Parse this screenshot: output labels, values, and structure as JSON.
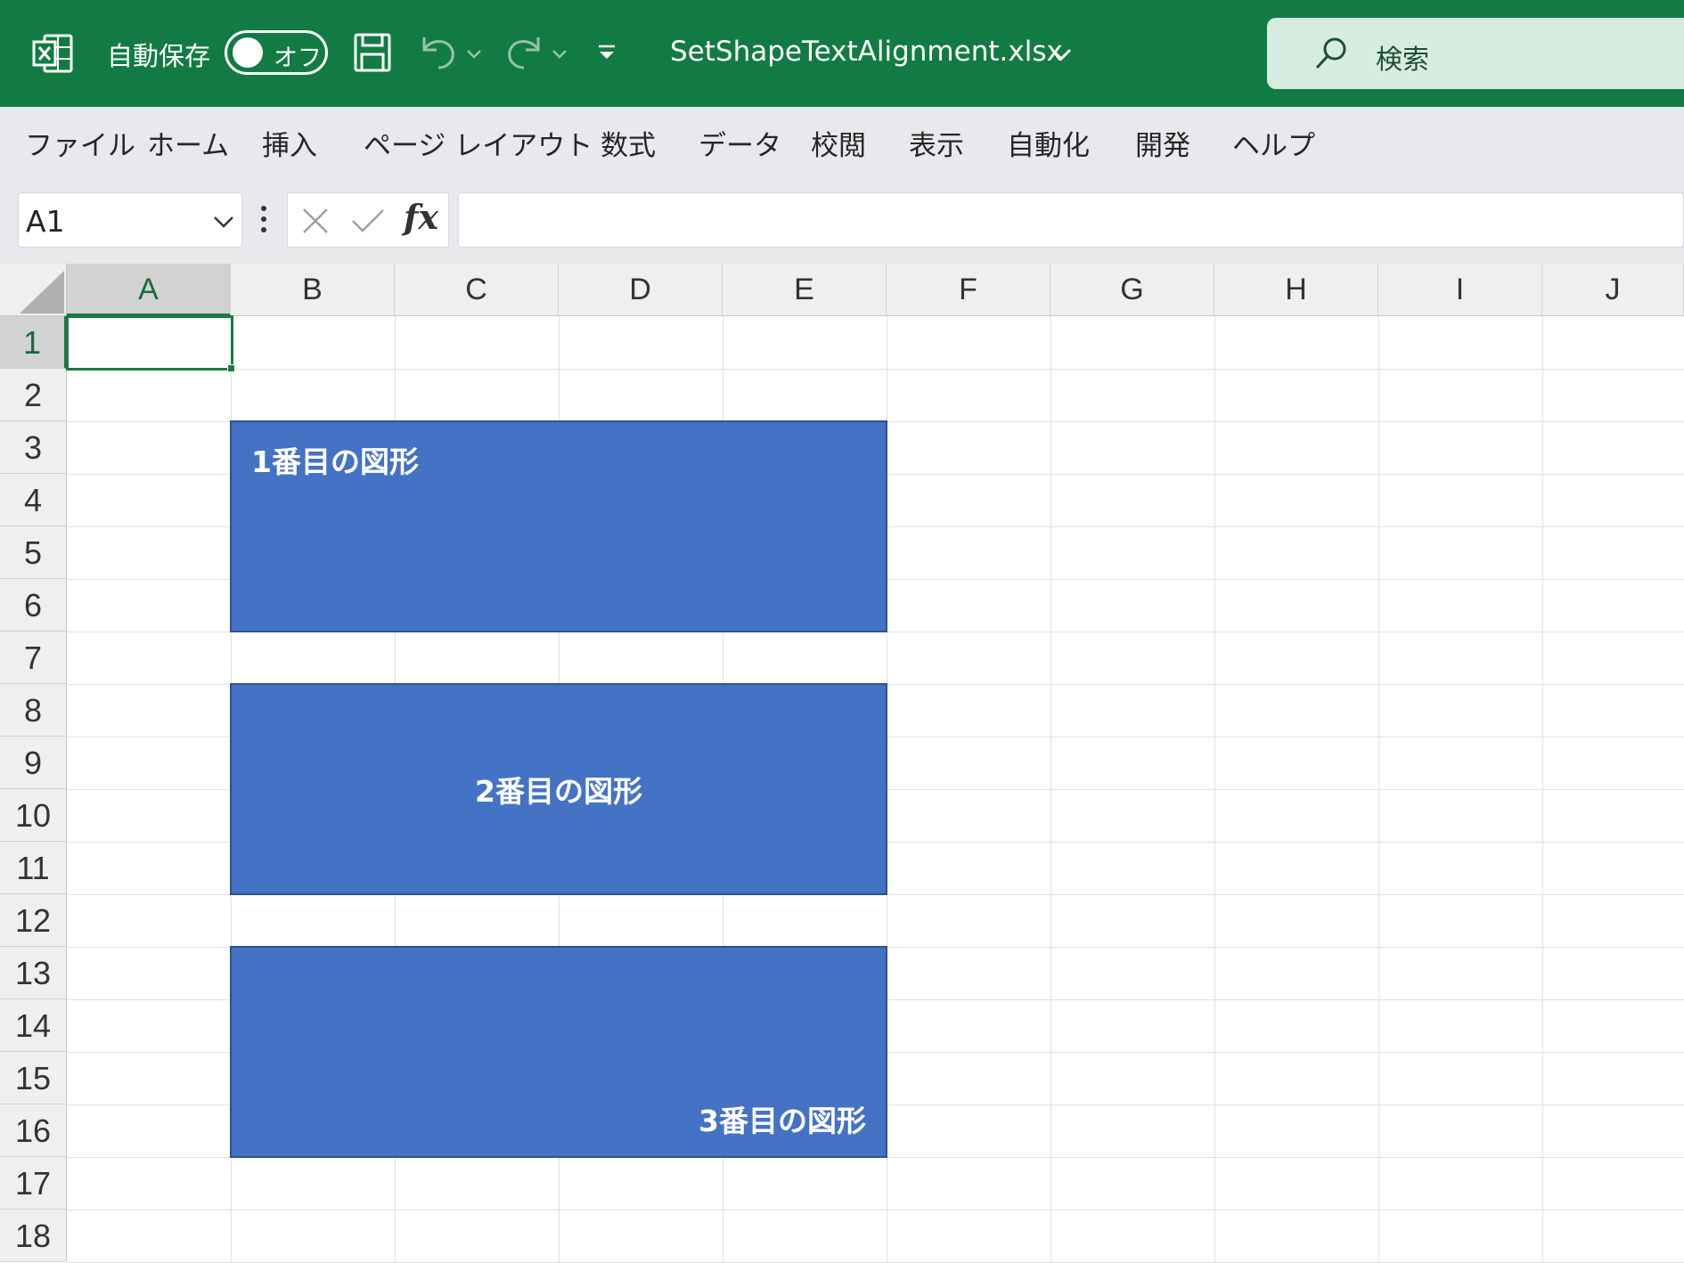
{
  "titlebar": {
    "app_icon": "excel-logo-icon",
    "autosave_label": "自動保存",
    "autosave_state": "オフ",
    "save_icon": "save-icon",
    "undo_icon": "undo-icon",
    "redo_icon": "redo-icon",
    "filename": "SetShapeTextAlignment.xlsx",
    "search_placeholder": "検索",
    "bg_color": "#127b43"
  },
  "ribbon": {
    "tabs": [
      "ファイル",
      "ホーム",
      "挿入",
      "ページ レイアウト",
      "数式",
      "データ",
      "校閲",
      "表示",
      "自動化",
      "開発",
      "ヘルプ"
    ]
  },
  "formula_bar": {
    "name_box": "A1",
    "fx_label": "fx",
    "formula": ""
  },
  "sheet": {
    "columns": [
      "A",
      "B",
      "C",
      "D",
      "E",
      "F",
      "G",
      "H",
      "I",
      "J"
    ],
    "rows": [
      "1",
      "2",
      "3",
      "4",
      "5",
      "6",
      "7",
      "8",
      "9",
      "10",
      "11",
      "12",
      "13",
      "14",
      "15",
      "16",
      "17",
      "18"
    ],
    "active_cell": "A1",
    "shapes": [
      {
        "text": "1番目の図形",
        "alignment": "top-left",
        "fill": "#4472c4"
      },
      {
        "text": "2番目の図形",
        "alignment": "middle-center",
        "fill": "#4472c4"
      },
      {
        "text": "3番目の図形",
        "alignment": "bottom-right",
        "fill": "#4472c4"
      }
    ]
  }
}
